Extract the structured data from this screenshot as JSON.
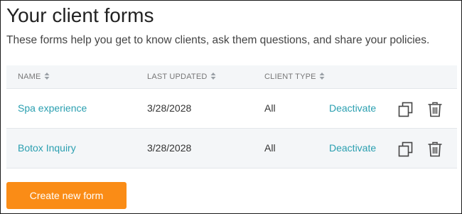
{
  "page": {
    "title": "Your client forms",
    "subtitle": "These forms help you get to know clients, ask them questions, and share your policies."
  },
  "table": {
    "columns": [
      {
        "label": "NAME",
        "sortable": true
      },
      {
        "label": "LAST UPDATED",
        "sortable": true
      },
      {
        "label": "CLIENT TYPE",
        "sortable": true
      }
    ],
    "rows": [
      {
        "name": "Spa experience",
        "last_updated": "3/28/2028",
        "client_type": "All",
        "action": "Deactivate"
      },
      {
        "name": "Botox Inquiry",
        "last_updated": "3/28/2028",
        "client_type": "All",
        "action": "Deactivate"
      }
    ],
    "row_icons": [
      "copy-icon",
      "trash-icon"
    ]
  },
  "create_button": {
    "label": "Create new form"
  },
  "colors": {
    "accent_link": "#2a9fb0",
    "primary_button": "#fa8c16",
    "header_bg": "#f4f6f8"
  }
}
